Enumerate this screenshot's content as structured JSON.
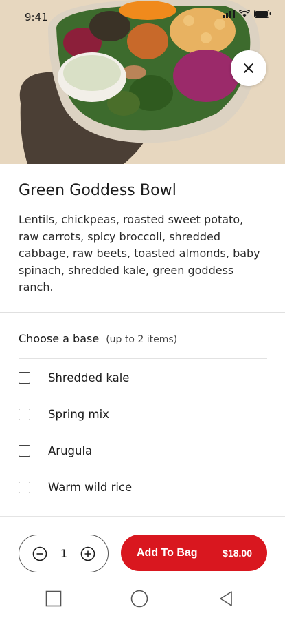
{
  "status_bar": {
    "time": "9:41"
  },
  "item": {
    "title": "Green Goddess Bowl",
    "description": "Lentils, chickpeas, roasted sweet potato, raw carrots, spicy broccoli, shredded cabbage, raw beets, toasted almonds, baby spinach, shredded kale, green goddess ranch."
  },
  "base_section": {
    "title": "Choose a base",
    "hint": "(up to 2 items)",
    "options": [
      {
        "label": "Shredded kale",
        "checked": false
      },
      {
        "label": "Spring mix",
        "checked": false
      },
      {
        "label": "Arugula",
        "checked": false
      },
      {
        "label": "Warm wild rice",
        "checked": false
      }
    ]
  },
  "order": {
    "quantity": "1",
    "add_label": "Add To Bag",
    "price": "$18.00"
  },
  "colors": {
    "accent": "#d9171f",
    "hero_background": "#e7d7bf"
  },
  "icons": {
    "close": "close-icon",
    "decrement": "minus-circle-icon",
    "increment": "plus-circle-icon",
    "nav_recents": "square-icon",
    "nav_home": "circle-icon",
    "nav_back": "triangle-back-icon"
  }
}
